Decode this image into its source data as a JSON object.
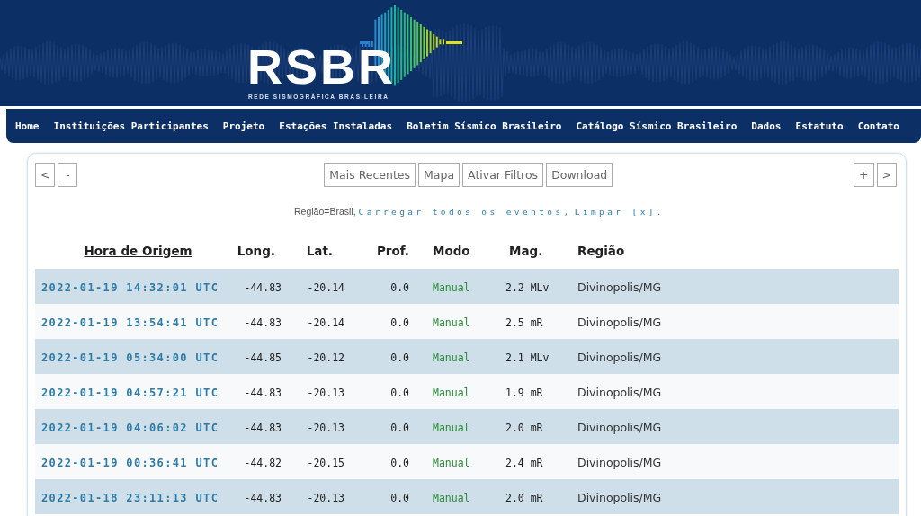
{
  "header": {
    "logo_text": "RSBR",
    "logo_subtitle": "REDE SISMOGRÁFICA BRASILEIRA"
  },
  "nav": [
    "Home",
    "Instituições Participantes",
    "Projeto",
    "Estações Instaladas",
    "Boletim Sísmico Brasileiro",
    "Catálogo Sísmico Brasileiro",
    "Dados",
    "Estatuto",
    "Contato"
  ],
  "toolbar": {
    "left_buttons": [
      "<",
      "-"
    ],
    "center_buttons": [
      "Mais Recentes",
      "Mapa",
      "Ativar Filtros",
      "Download"
    ],
    "right_buttons": [
      "+",
      ">"
    ]
  },
  "filter": {
    "text": "Região=Brasil,",
    "links": [
      "Carregar todos os eventos,",
      "Limpar [x]."
    ]
  },
  "table": {
    "columns": [
      {
        "label": "Hora de Origem",
        "sorted": true
      },
      {
        "label": "Long.",
        "sorted": false
      },
      {
        "label": "Lat.",
        "sorted": false
      },
      {
        "label": "Prof.",
        "sorted": false
      },
      {
        "label": "Modo",
        "sorted": false
      },
      {
        "label": "Mag.",
        "sorted": false
      },
      {
        "label": "Região",
        "sorted": false
      }
    ],
    "rows": [
      {
        "time": "2022-01-19 14:32:01 UTC",
        "long": "-44.83",
        "lat": "-20.14",
        "prof": "0.0",
        "mode": "Manual",
        "mag": "2.2 MLv",
        "region": "Divinopolis/MG"
      },
      {
        "time": "2022-01-19 13:54:41 UTC",
        "long": "-44.83",
        "lat": "-20.14",
        "prof": "0.0",
        "mode": "Manual",
        "mag": "2.5 mR",
        "region": "Divinopolis/MG"
      },
      {
        "time": "2022-01-19 05:34:00 UTC",
        "long": "-44.85",
        "lat": "-20.12",
        "prof": "0.0",
        "mode": "Manual",
        "mag": "2.1 MLv",
        "region": "Divinopolis/MG"
      },
      {
        "time": "2022-01-19 04:57:21 UTC",
        "long": "-44.83",
        "lat": "-20.13",
        "prof": "0.0",
        "mode": "Manual",
        "mag": "1.9 mR",
        "region": "Divinopolis/MG"
      },
      {
        "time": "2022-01-19 04:06:02 UTC",
        "long": "-44.83",
        "lat": "-20.13",
        "prof": "0.0",
        "mode": "Manual",
        "mag": "2.0 mR",
        "region": "Divinopolis/MG"
      },
      {
        "time": "2022-01-19 00:36:41 UTC",
        "long": "-44.82",
        "lat": "-20.15",
        "prof": "0.0",
        "mode": "Manual",
        "mag": "2.4 mR",
        "region": "Divinopolis/MG"
      },
      {
        "time": "2022-01-18 23:11:13 UTC",
        "long": "-44.83",
        "lat": "-20.13",
        "prof": "0.0",
        "mode": "Manual",
        "mag": "2.0 mR",
        "region": "Divinopolis/MG"
      }
    ]
  }
}
